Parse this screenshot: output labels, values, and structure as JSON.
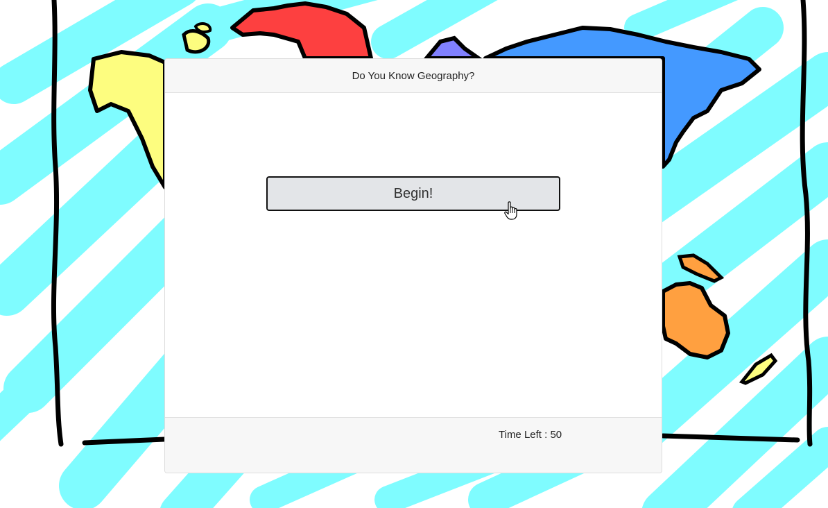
{
  "app": {
    "title": "Do You Know Geography?"
  },
  "quiz": {
    "begin_label": "Begin!",
    "timer_label": "Time Left : ",
    "timer_value": "50"
  },
  "colors": {
    "ocean_scribble": "#7ffcff",
    "north_america": "#fdfd7f",
    "europe": "#fd4040",
    "asia": "#4499ff",
    "oceania": "#ffa040",
    "outline": "#000000",
    "card_header_bg": "#f7f7f7",
    "button_bg": "#e3e5e8"
  },
  "icons": {
    "pointer": "hand-pointer-cursor"
  }
}
